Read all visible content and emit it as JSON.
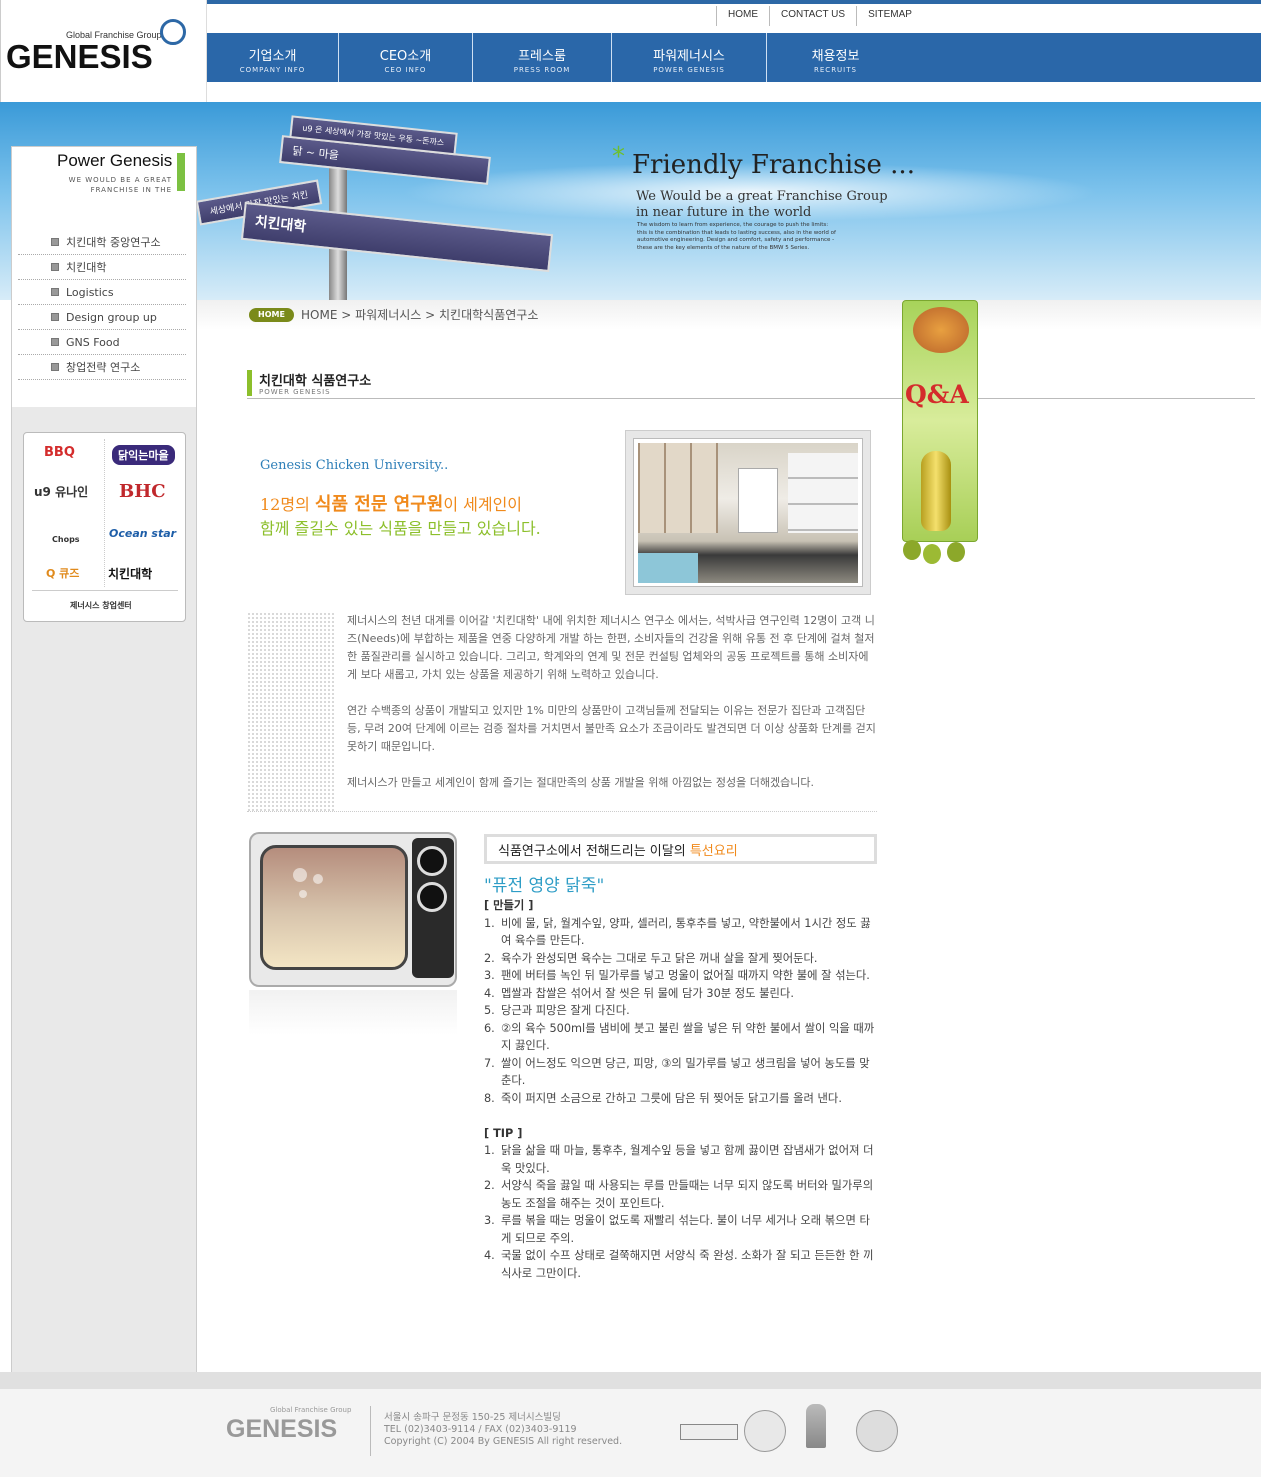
{
  "header": {
    "logo_sub": "Global Franchise Group",
    "logo_main": "GENESIS",
    "util_links": [
      "HOME",
      "CONTACT US",
      "SITEMAP"
    ],
    "nav": [
      {
        "ko": "기업소개",
        "en": "COMPANY INFO"
      },
      {
        "ko": "CEO소개",
        "en": "CEO INFO"
      },
      {
        "ko": "프레스룸",
        "en": "PRESS ROOM"
      },
      {
        "ko": "파워제너시스",
        "en": "POWER GENESIS"
      },
      {
        "ko": "채용정보",
        "en": "RECRUITS"
      }
    ]
  },
  "hero": {
    "signs": [
      "u9 은 세상에서 가장 맛있는 우동 ~돈까스",
      "닭 ~ 마을",
      "세상에서 가장 맛있는 치킨",
      "치킨대학"
    ],
    "title": "Friendly Franchise ...",
    "subtitle": "We Would be a great Franchise Group in near future in the world",
    "small": "The wisdom to learn from experience, the courage to push the limits: this is the combination that leads to lasting success, also in the world of automotive engineering. Design and comfort, safety and performance - these are the key elements of the nature of the BMW 5 Series."
  },
  "sidebar": {
    "title": "Power Genesis",
    "subtitle_1": "WE WOULD BE A GREAT",
    "subtitle_2": "FRANCHISE IN THE WORLD",
    "items": [
      "치킨대학 중앙연구소",
      "치킨대학",
      "Logistics",
      "Design group up",
      "GNS Food",
      "창업전략 연구소"
    ],
    "brands": [
      "BBQ",
      "닭익는마을",
      "u9 유나인",
      "BHC",
      "Chops",
      "Ocean star",
      "Q 큐즈",
      "치킨대학"
    ],
    "brand_foot": "제너시스 창업센터"
  },
  "breadcrumb": {
    "home_pill": "HOME",
    "path": "HOME > 파워제너시스 > 치킨대학식품연구소"
  },
  "page": {
    "title": "치킨대학 식품연구소",
    "subtitle": "POWER GENESIS"
  },
  "intro": {
    "en": "Genesis Chicken University..",
    "ko_line1_pre": "12명의 ",
    "ko_line1_em": "식품 전문 연구원",
    "ko_line1_post": "이 세계인이",
    "ko_line2": "함께 즐길수 있는 식품을 만들고 있습니다."
  },
  "qna": {
    "label": "Q&A"
  },
  "body": {
    "p1": "제너시스의 천년 대계를 이어갈 '치킨대학' 내에 위치한 제너시스 연구소 에서는, 석박사급 연구인력 12명이 고객 니즈(Needs)에 부합하는 제품을 연중 다양하게 개발 하는 한편, 소비자들의 건강을 위해 유통 전 후 단계에 걸쳐 철저한 품질관리를 실시하고 있습니다. 그리고, 학계와의 연계 및 전문 컨설팅 업체와의 공동 프로젝트를 통해 소비자에게 보다 새롭고, 가치 있는 상품을 제공하기 위해 노력하고 있습니다.",
    "p2": "연간 수백종의 상품이 개발되고 있지만 1% 미만의 상품만이 고객님들께 전달되는 이유는 전문가 집단과 고객집단 등, 무려 20여 단계에 이르는 검증 절차를 거치면서 불만족 요소가 조금이라도 발견되면 더 이상 상품화 단계를 걷지 못하기 때문입니다.",
    "p3": "제너시스가 만들고 세계인이 함께 즐기는 절대만족의 상품 개발을 위해 아낌없는 정성을 더해겠습니다."
  },
  "recipe": {
    "head_pre": "식품연구소에서 전해드리는 이달의 ",
    "head_em": "특선요리",
    "title": "\"퓨전 영양 닭죽\"",
    "make_label": "[ 만들기 ]",
    "steps": [
      "비에 물, 닭, 월계수잎, 양파, 셀러리, 통후추를 넣고, 약한불에서 1시간 정도 끓여 육수를 만든다.",
      "육수가 완성되면 육수는 그대로 두고 닭은 꺼내 살을 잘게 찢어둔다.",
      "팬에 버터를 녹인 뒤 밀가루를 넣고 멍울이 없어질 때까지 약한 불에 잘 섞는다.",
      "멥쌀과 찹쌀은 섞어서 잘 씻은 뒤 물에 담가 30분 정도 불린다.",
      "당근과 피망은 잘게 다진다.",
      "②의 육수 500ml를 냄비에 붓고 불린 쌀을 넣은 뒤 약한 불에서 쌀이 익을 때까지 끓인다.",
      "쌀이 어느정도 익으면 당근, 피망, ③의 밀가루를 넣고 생크림을 넣어 농도를 맞춘다.",
      "죽이 퍼지면 소금으로 간하고 그릇에 담은 뒤 찢어둔 닭고기를 올려 낸다."
    ],
    "tip_label": "[ TIP ]",
    "tips": [
      "닭을 삶을 때 마늘, 통후추, 월계수잎 등을 넣고 함께 끓이면 잡냄새가 없어져 더욱 맛있다.",
      "서양식 죽을 끓일 때 사용되는 루를 만들때는 너무 되지 않도록 버터와 밀가루의 농도 조절을 해주는 것이 포인트다.",
      "루를 볶을 때는 멍울이 없도록 재빨리 섞는다. 불이 너무 세거나 오래 볶으면 타게 되므로 주의.",
      "국물 없이 수프 상태로 걸쭉해지면 서양식 죽 완성. 소화가 잘 되고 든든한 한 끼 식사로 그만이다."
    ]
  },
  "footer": {
    "logo": "GENESIS",
    "logo_sub": "Global Franchise Group",
    "address": "서울시 송파구 문정동 150-25 제너시스빌딩",
    "tel": "TEL (02)3403-9114 / FAX (02)3403-9119",
    "copyright": "Copyright (C) 2004 By GENESIS All right reserved."
  },
  "colors": {
    "nav": "#2a67a9",
    "green": "#8cbf2b",
    "orange": "#f08a1c",
    "blue_text": "#2e7fb8"
  }
}
